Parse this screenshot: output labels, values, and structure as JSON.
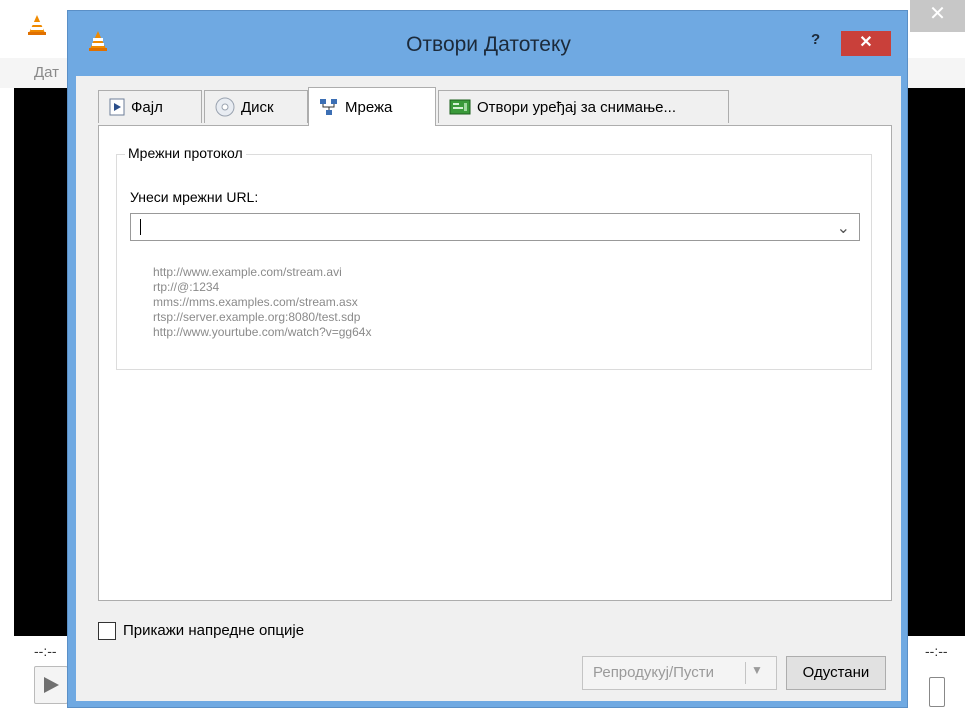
{
  "background_window": {
    "menu_partial": "Дат",
    "time_elapsed": "--:--",
    "time_total": "--:--",
    "close_glyph": "✕"
  },
  "dialog": {
    "title": "Отвори Датотеку",
    "help_label": "?",
    "close_glyph": "✕",
    "title_bar_color": "#6fa9e2"
  },
  "tabs": [
    {
      "label": "Фајл",
      "icon": "file-media-icon",
      "active": false
    },
    {
      "label": "Диск",
      "icon": "disc-icon",
      "active": false
    },
    {
      "label": "Мрежа",
      "icon": "network-icon",
      "active": true
    },
    {
      "label": "Отвори уређај за снимање...",
      "icon": "capture-device-icon",
      "active": false
    }
  ],
  "network": {
    "group_title": "Мрежни протокол",
    "url_label": "Унеси мрежни URL:",
    "url_value": "",
    "examples": [
      "http://www.example.com/stream.avi",
      "rtp://@:1234",
      "mms://mms.examples.com/stream.asx",
      "rtsp://server.example.org:8080/test.sdp",
      "http://www.yourtube.com/watch?v=gg64x"
    ]
  },
  "advanced_options": {
    "label": "Прикажи напредне опције",
    "checked": false
  },
  "buttons": {
    "play": "Репродукуј/Пусти",
    "cancel": "Одустани"
  }
}
